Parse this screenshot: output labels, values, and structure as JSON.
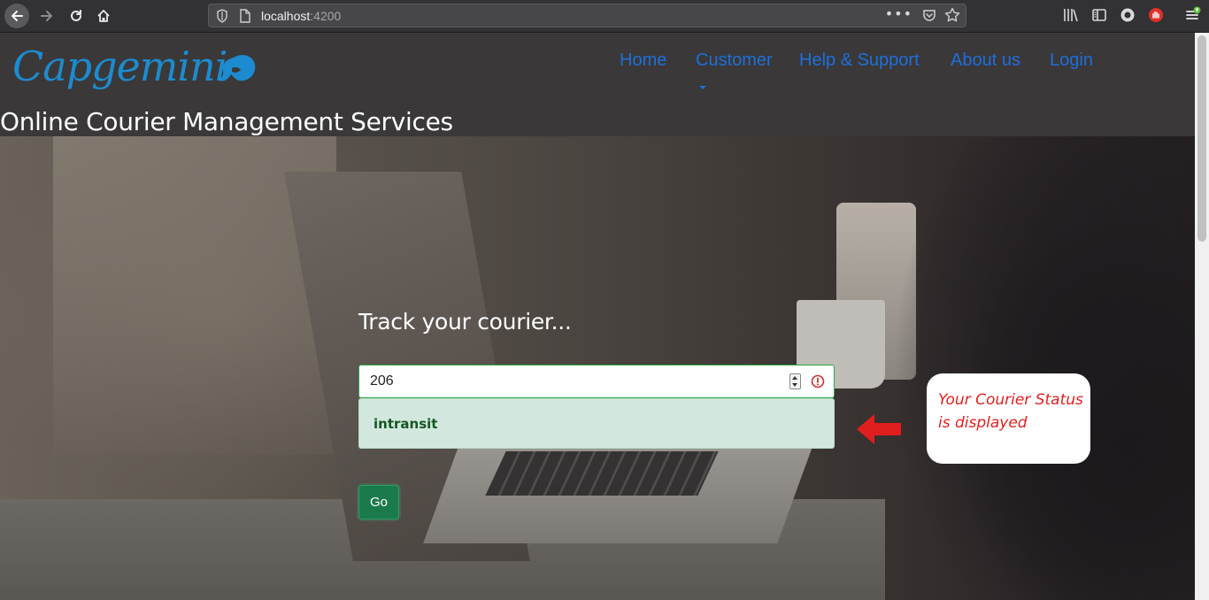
{
  "browser": {
    "url_host": "localhost",
    "url_port": ":4200",
    "page_actions_glyph": "•••"
  },
  "header": {
    "brand": "Capgemini",
    "site_title": "Online Courier Management Services",
    "nav": [
      {
        "label": "Home"
      },
      {
        "label": "Customer"
      },
      {
        "label": "Help & Support"
      },
      {
        "label": "About us"
      },
      {
        "label": "Login"
      }
    ]
  },
  "tracker": {
    "heading": "Track your courier...",
    "input_value": "206",
    "status": "intransit",
    "go_label": "Go"
  },
  "annotation": {
    "line1": "Your Courier Status",
    "line2": "is displayed"
  },
  "colors": {
    "nav_link": "#1e6fdc",
    "brand_blue": "#1d8bcf",
    "status_bg": "#d2e8de",
    "status_text": "#155724",
    "go_button": "#1a7a4c",
    "annotation_red": "#e0201e"
  }
}
